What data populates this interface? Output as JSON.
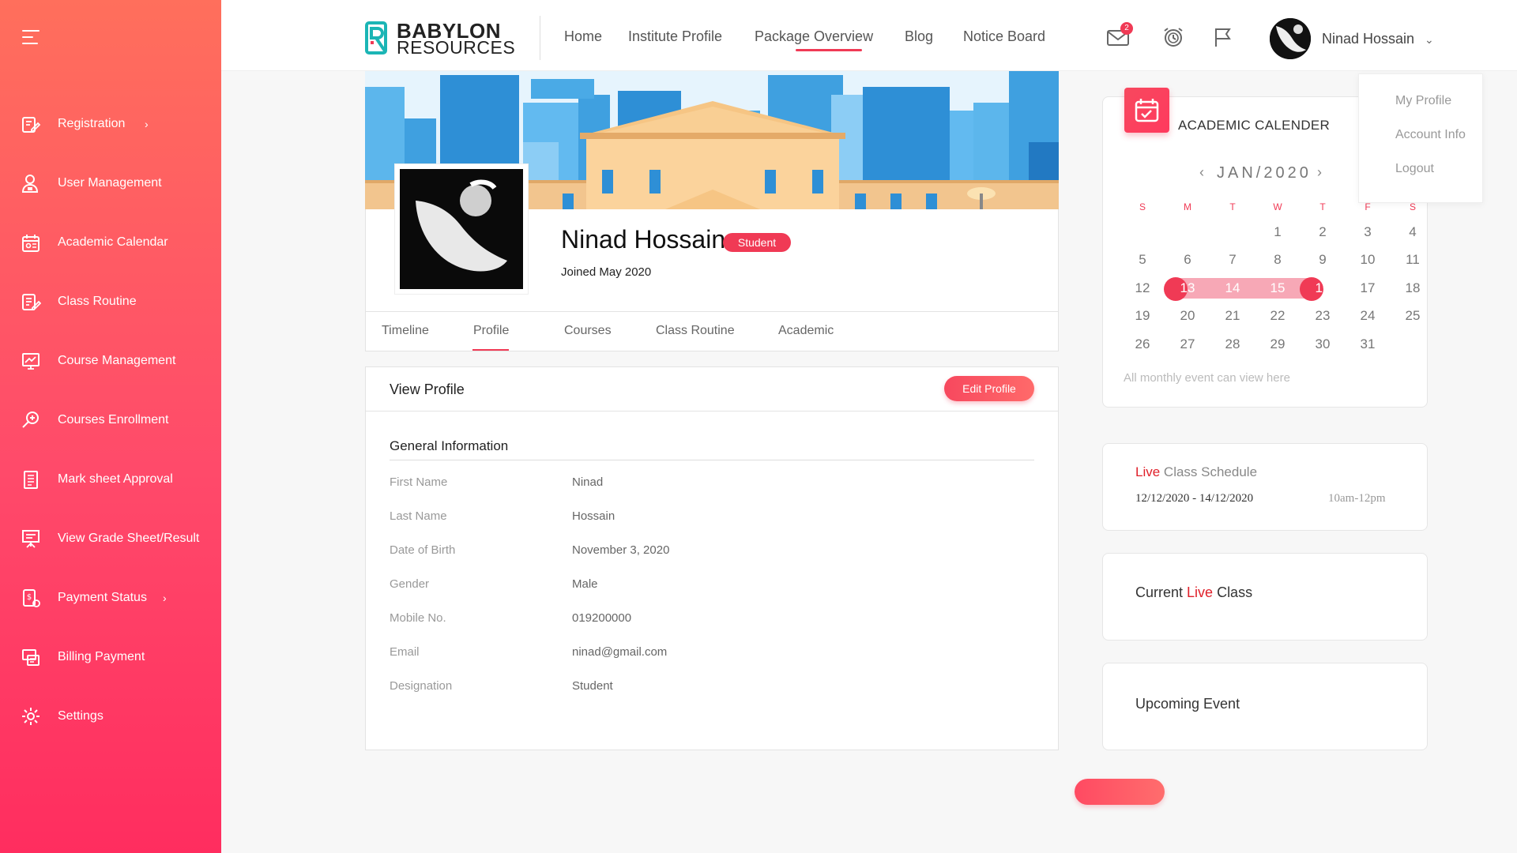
{
  "sidebar": {
    "items": [
      {
        "label": "Registration",
        "icon": "registration-icon",
        "has_chevron": true
      },
      {
        "label": "User Management",
        "icon": "user-management-icon"
      },
      {
        "label": "Academic Calendar",
        "icon": "academic-calendar-icon"
      },
      {
        "label": "Class Routine",
        "icon": "class-routine-icon"
      },
      {
        "label": "Course Management",
        "icon": "course-management-icon"
      },
      {
        "label": "Courses Enrollment",
        "icon": "courses-enrollment-icon"
      },
      {
        "label": "Mark sheet Approval",
        "icon": "mark-sheet-icon"
      },
      {
        "label": "View Grade Sheet/Result",
        "icon": "grade-sheet-icon"
      },
      {
        "label": "Payment Status",
        "icon": "payment-status-icon",
        "has_chevron": true
      },
      {
        "label": "Billing Payment",
        "icon": "billing-payment-icon"
      },
      {
        "label": "Settings",
        "icon": "settings-icon"
      }
    ],
    "chevron": "›"
  },
  "header": {
    "logo_top": "BABYLON",
    "logo_bottom": "RESOURCES",
    "nav": [
      "Home",
      "Institute Profile",
      "Package Overview",
      "Blog",
      "Notice Board"
    ],
    "active_nav": "Package Overview",
    "mail_badge": "2",
    "user_name": "Ninad Hossain",
    "user_chevron": "⌄"
  },
  "dropdown": {
    "items": [
      "My Profile",
      "Account Info",
      "Logout"
    ]
  },
  "profile": {
    "name": "Ninad Hossain",
    "role_badge": "Student",
    "joined": "Joined May 2020",
    "tabs": [
      "Timeline",
      "Profile",
      "Courses",
      "Class Routine",
      "Academic"
    ],
    "active_tab": "Profile"
  },
  "view_profile": {
    "title": "View Profile",
    "edit_button": "Edit Profile",
    "section_title": "General Information",
    "fields": [
      {
        "label": "First Name",
        "value": "Ninad"
      },
      {
        "label": "Last Name",
        "value": "Hossain"
      },
      {
        "label": "Date of Birth",
        "value": "November 3, 2020"
      },
      {
        "label": "Gender",
        "value": "Male"
      },
      {
        "label": "Mobile No.",
        "value": "019200000"
      },
      {
        "label": "Email",
        "value": "ninad@gmail.com"
      },
      {
        "label": "Designation",
        "value": "Student"
      }
    ]
  },
  "calendar": {
    "title": "ACADEMIC CALENDER",
    "month": "JAN/2020",
    "prev": "‹",
    "next": "›",
    "weekdays": [
      "S",
      "M",
      "T",
      "W",
      "T",
      "F",
      "S"
    ],
    "weeks": [
      [
        "",
        "",
        "",
        "1",
        "2",
        "3",
        "4"
      ],
      [
        "5",
        "6",
        "7",
        "8",
        "9",
        "10",
        "11"
      ],
      [
        "12",
        "13",
        "14",
        "15",
        "16",
        "17",
        "18"
      ],
      [
        "19",
        "20",
        "21",
        "22",
        "23",
        "24",
        "25"
      ],
      [
        "26",
        "27",
        "28",
        "29",
        "30",
        "31",
        ""
      ]
    ],
    "range_start": "13",
    "range_end": "16",
    "footer": "All monthly event can view here",
    "accent": "#f03a55"
  },
  "live_schedule": {
    "title_red": "Live",
    "title_rest": " Class Schedule",
    "dates": "12/12/2020 - 14/12/2020",
    "time": "10am-12pm"
  },
  "current_live": {
    "prefix": "Current ",
    "red": "Live",
    "suffix": " Class"
  },
  "upcoming": {
    "title": "Upcoming Event"
  },
  "colors": {
    "accent": "#f03a55",
    "sidebar_top": "#ff6f5c",
    "sidebar_bottom": "#ff2d5f"
  }
}
